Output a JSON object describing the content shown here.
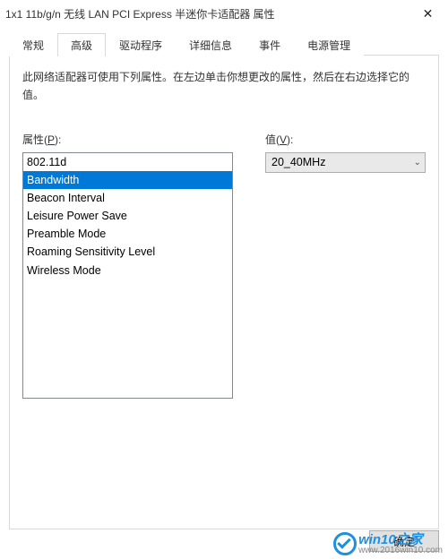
{
  "window": {
    "title": "1x1 11b/g/n 无线 LAN PCI Express 半迷你卡适配器 属性",
    "close_glyph": "✕"
  },
  "tabs": [
    {
      "label": "常规"
    },
    {
      "label": "高级"
    },
    {
      "label": "驱动程序"
    },
    {
      "label": "详细信息"
    },
    {
      "label": "事件"
    },
    {
      "label": "电源管理"
    }
  ],
  "active_tab_index": 1,
  "description": "此网络适配器可使用下列属性。在左边单击你想更改的属性，然后在右边选择它的值。",
  "property_label_prefix": "属性(",
  "property_label_key": "P",
  "property_label_suffix": "):",
  "value_label_prefix": "值(",
  "value_label_key": "V",
  "value_label_suffix": "):",
  "properties": [
    "802.11d",
    "Bandwidth",
    "Beacon Interval",
    "Leisure Power Save",
    "Preamble Mode",
    "Roaming Sensitivity Level",
    "Wireless Mode"
  ],
  "selected_property_index": 1,
  "value_selected": "20_40MHz",
  "buttons": {
    "ok": "确定"
  },
  "watermark": {
    "line1": "win10之家",
    "line2": "www.2016win10.com"
  }
}
